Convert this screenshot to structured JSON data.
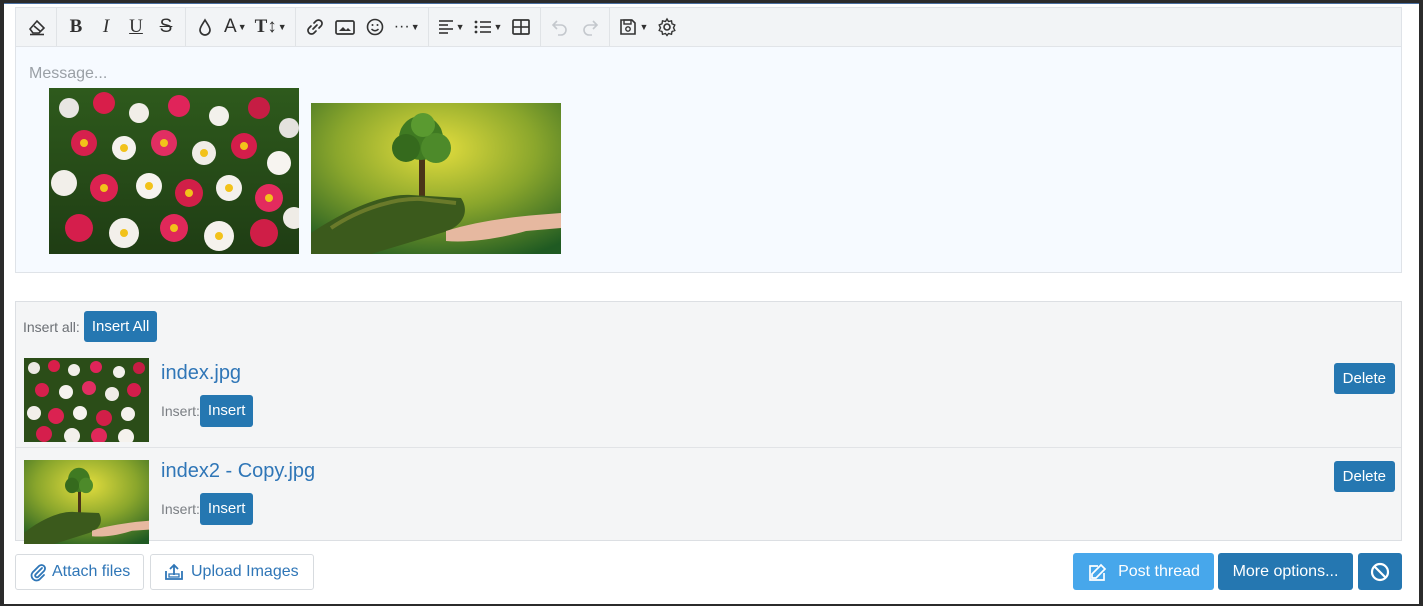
{
  "editor": {
    "placeholder": "Message...",
    "toolbar": [
      {
        "name": "clear-formatting-icon"
      },
      {
        "name": "bold-icon",
        "label": "B"
      },
      {
        "name": "italic-icon",
        "label": "I"
      },
      {
        "name": "underline-icon",
        "label": "U"
      },
      {
        "name": "strikethrough-icon",
        "label": "S"
      },
      {
        "name": "text-color-icon"
      },
      {
        "name": "font-family-icon",
        "label": "A"
      },
      {
        "name": "font-size-icon",
        "label": "T↕"
      },
      {
        "name": "link-icon"
      },
      {
        "name": "image-icon"
      },
      {
        "name": "emoji-icon"
      },
      {
        "name": "more-icon"
      },
      {
        "name": "align-icon"
      },
      {
        "name": "list-icon"
      },
      {
        "name": "table-icon"
      },
      {
        "name": "undo-icon"
      },
      {
        "name": "redo-icon"
      },
      {
        "name": "drafts-icon"
      },
      {
        "name": "settings-icon"
      }
    ],
    "images": [
      "flowers-image",
      "tree-hand-image"
    ]
  },
  "attachments": {
    "insert_all_label": "Insert all:",
    "insert_all_button": "Insert All",
    "files": [
      {
        "name": "index.jpg",
        "insert_label": "Insert:",
        "insert_button": "Insert",
        "delete_button": "Delete"
      },
      {
        "name": "index2 - Copy.jpg",
        "insert_label": "Insert:",
        "insert_button": "Insert",
        "delete_button": "Delete"
      }
    ]
  },
  "footer": {
    "attach_files": "Attach files",
    "upload_images": "Upload Images",
    "post_thread": "Post thread",
    "more_options": "More options..."
  },
  "colors": {
    "primary": "#2577b1",
    "post": "#47a7eb",
    "link": "#2f76b7"
  }
}
